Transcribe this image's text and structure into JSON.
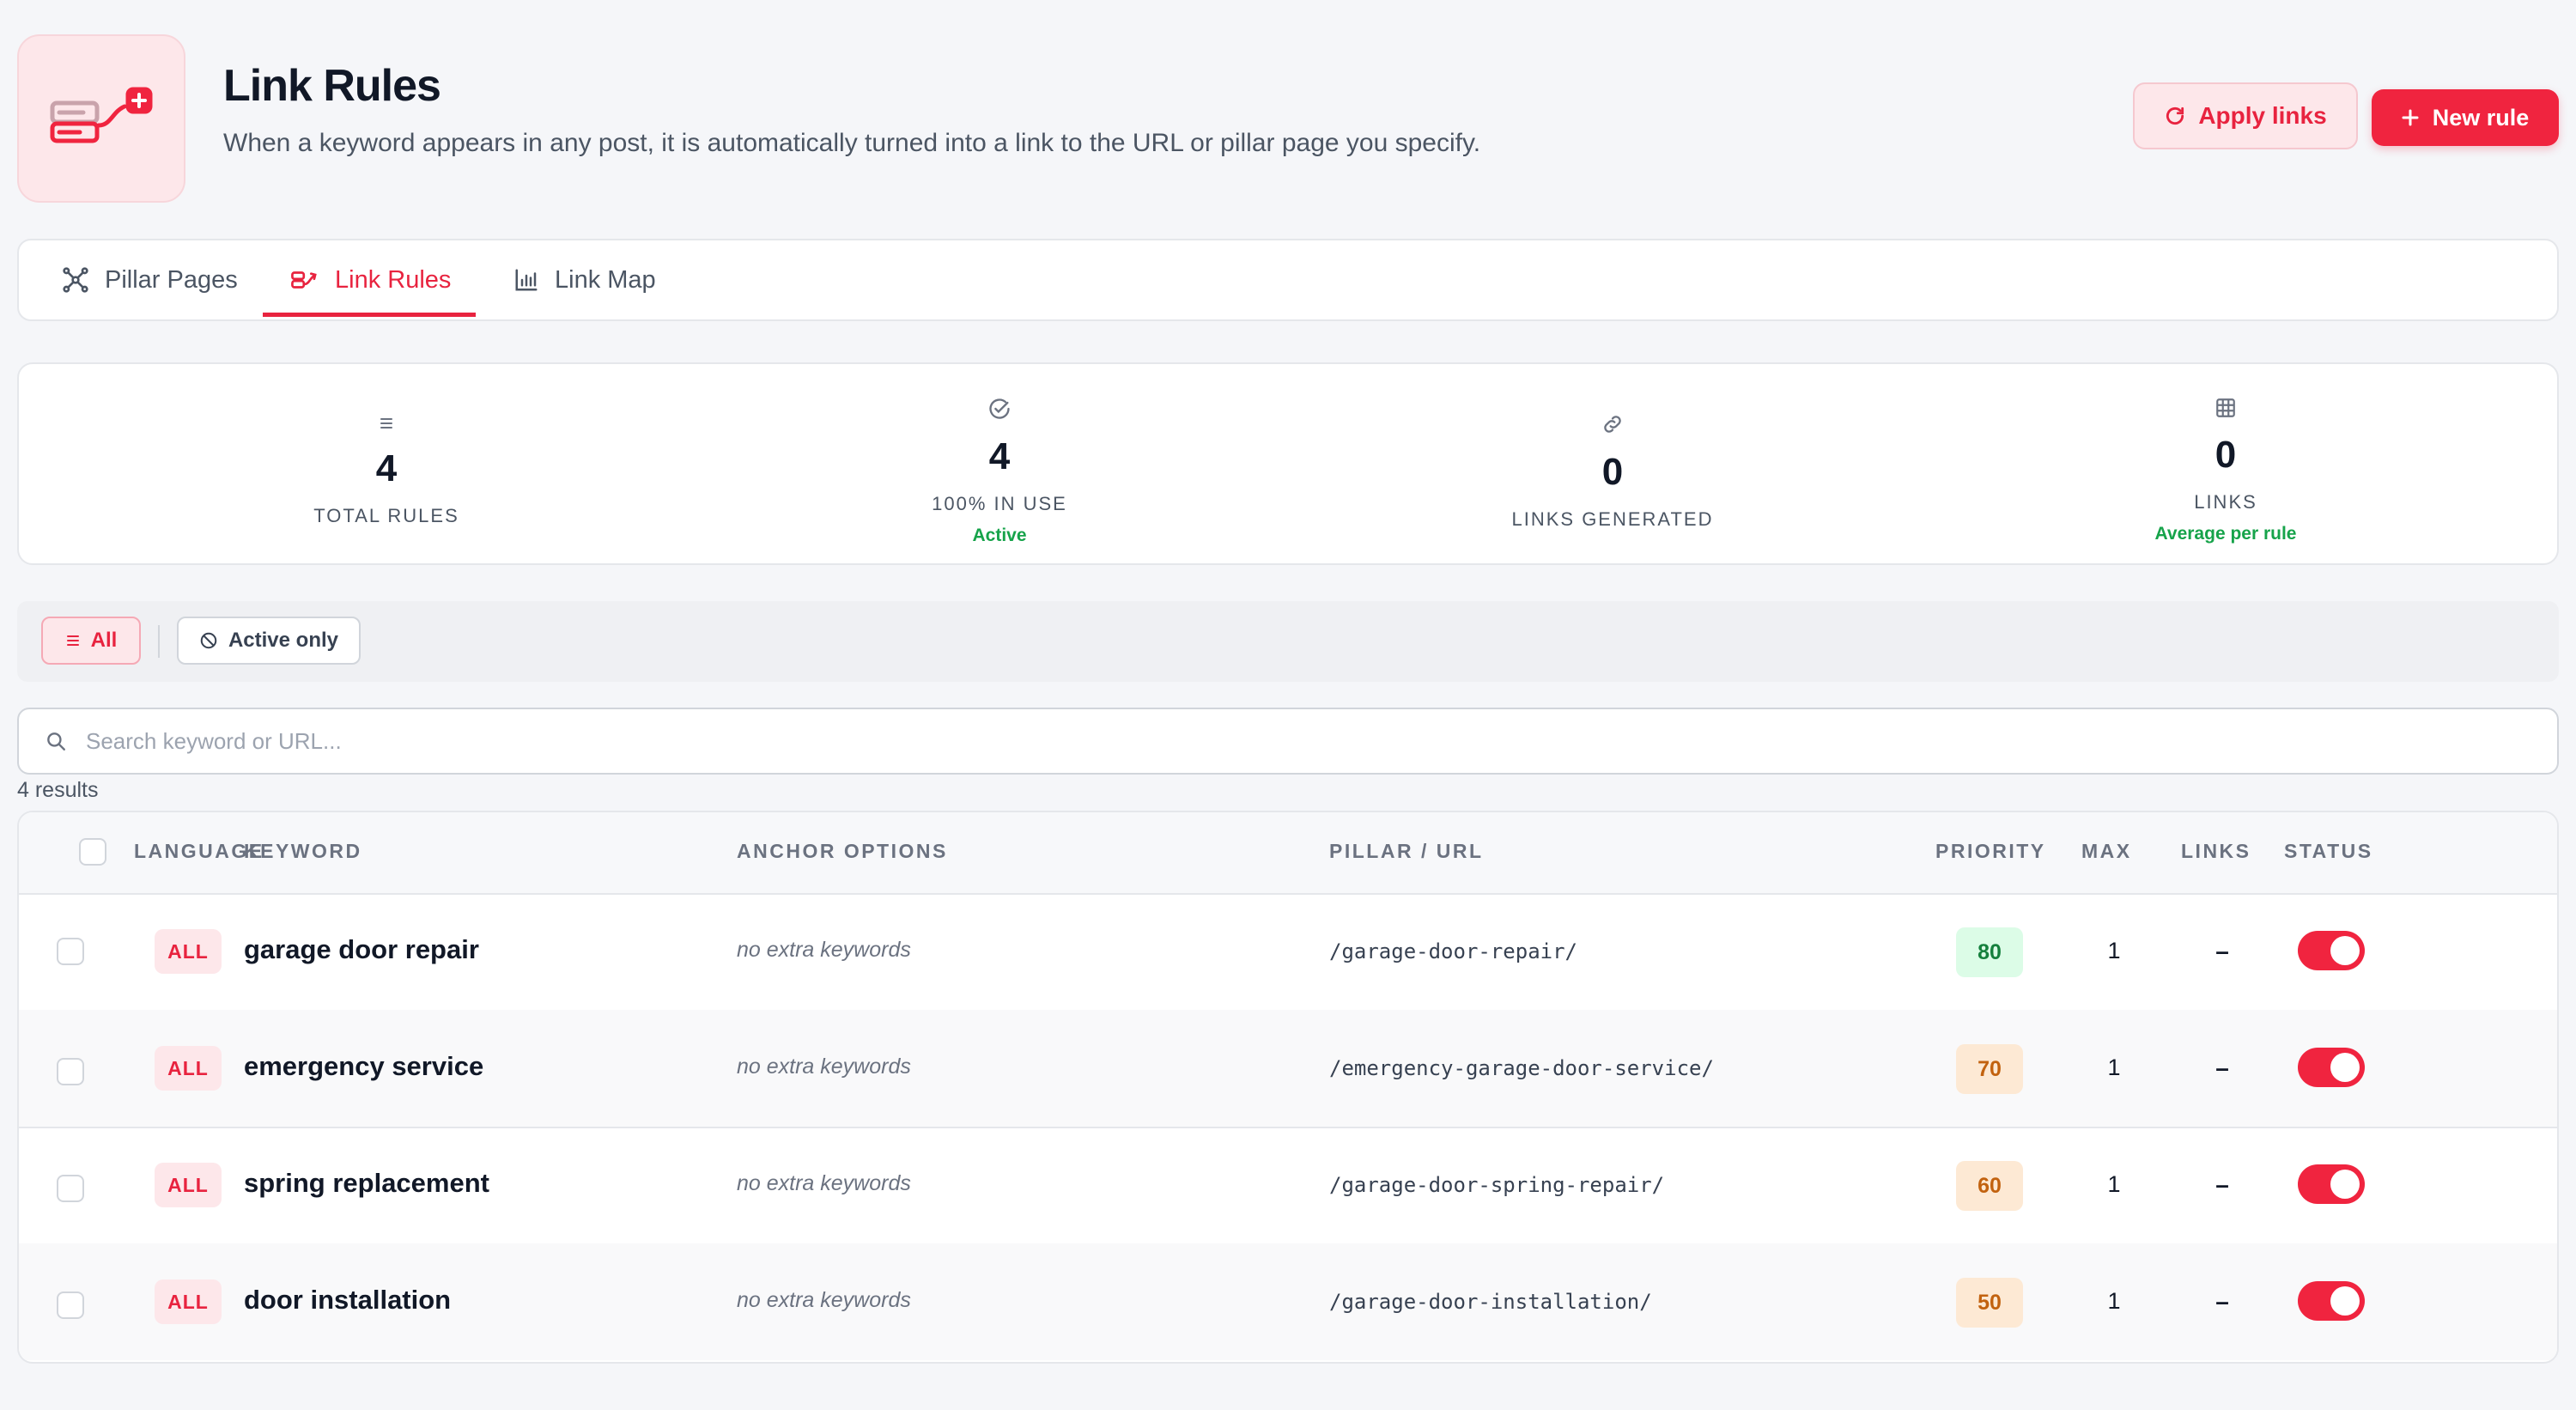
{
  "header": {
    "title": "Link Rules",
    "subtitle": "When a keyword appears in any post, it is automatically turned into a link to the URL or pillar page you specify.",
    "apply_label": "Apply links",
    "new_label": "New rule",
    "accent_color": "#f0243f"
  },
  "tabs": [
    {
      "label": "Pillar Pages",
      "icon": "nodes-icon",
      "active": false
    },
    {
      "label": "Link Rules",
      "icon": "link-rule-icon",
      "active": true
    },
    {
      "label": "Link Map",
      "icon": "bar-chart-icon",
      "active": false
    }
  ],
  "stats": [
    {
      "icon": "list-icon",
      "value": "4",
      "label": "TOTAL RULES",
      "sub": ""
    },
    {
      "icon": "check-circle-icon",
      "value": "4",
      "label": "100% IN USE",
      "sub": "Active"
    },
    {
      "icon": "link-icon",
      "value": "0",
      "label": "LINKS GENERATED",
      "sub": ""
    },
    {
      "icon": "grid-icon",
      "value": "0",
      "label": "LINKS",
      "sub": "Average per rule"
    }
  ],
  "filters": {
    "all_label": "All",
    "active_label": "Active only"
  },
  "search": {
    "placeholder": "Search keyword or URL...",
    "value": ""
  },
  "results_text": "4 results",
  "table": {
    "columns": {
      "language": "LANGUAGE",
      "keyword": "KEYWORD",
      "anchor": "ANCHOR OPTIONS",
      "pillar": "PILLAR / URL",
      "priority": "PRIORITY",
      "max": "MAX",
      "links": "LINKS",
      "status": "STATUS"
    },
    "rows": [
      {
        "language": "ALL",
        "keyword": "garage door repair",
        "anchor": "no extra keywords",
        "url": "/garage-door-repair/",
        "priority": "80",
        "max": "1",
        "links": "–",
        "status": "on"
      },
      {
        "language": "ALL",
        "keyword": "emergency service",
        "anchor": "no extra keywords",
        "url": "/emergency-garage-door-service/",
        "priority": "70",
        "max": "1",
        "links": "–",
        "status": "on"
      },
      {
        "language": "ALL",
        "keyword": "spring replacement",
        "anchor": "no extra keywords",
        "url": "/garage-door-spring-repair/",
        "priority": "60",
        "max": "1",
        "links": "–",
        "status": "on"
      },
      {
        "language": "ALL",
        "keyword": "door installation",
        "anchor": "no extra keywords",
        "url": "/garage-door-installation/",
        "priority": "50",
        "max": "1",
        "links": "–",
        "status": "on"
      }
    ]
  }
}
